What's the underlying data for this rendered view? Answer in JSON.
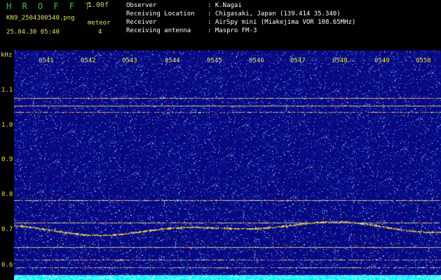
{
  "header": {
    "logo": "H R O F F T",
    "version": "1.00f",
    "filename": "KN9_2504300540.png",
    "mode_label": "meteor",
    "datetime": "25.04.30 05:40",
    "count": "4",
    "fields": [
      {
        "label": "Observer",
        "value": ": K.Nagai"
      },
      {
        "label": "Receiving Location",
        "value": ": Chigasaki, Japan (139.414 35.340)"
      },
      {
        "label": "Receiver",
        "value": ": AirSpy mini (Miakejima VOR 108.65MHz)"
      },
      {
        "label": "Receiving antenna",
        "value": ": Maspro FM-3"
      }
    ]
  },
  "axis": {
    "unit": "kHz",
    "freq_ticks": [
      "1.1",
      "1.0",
      "0.9",
      "0.8",
      "0.7",
      "0.6"
    ],
    "time_ticks": [
      "0541",
      "0542",
      "0543",
      "0544",
      "0545",
      "0546",
      "0547",
      "0548",
      "0549",
      "0550"
    ]
  },
  "colors": {
    "background": "#000000",
    "label_yellow": "#e0e060",
    "logo_green": "#3fbf3f",
    "spectrogram_base": "#0a0a7a",
    "noise_floor": "#00e5ff"
  }
}
